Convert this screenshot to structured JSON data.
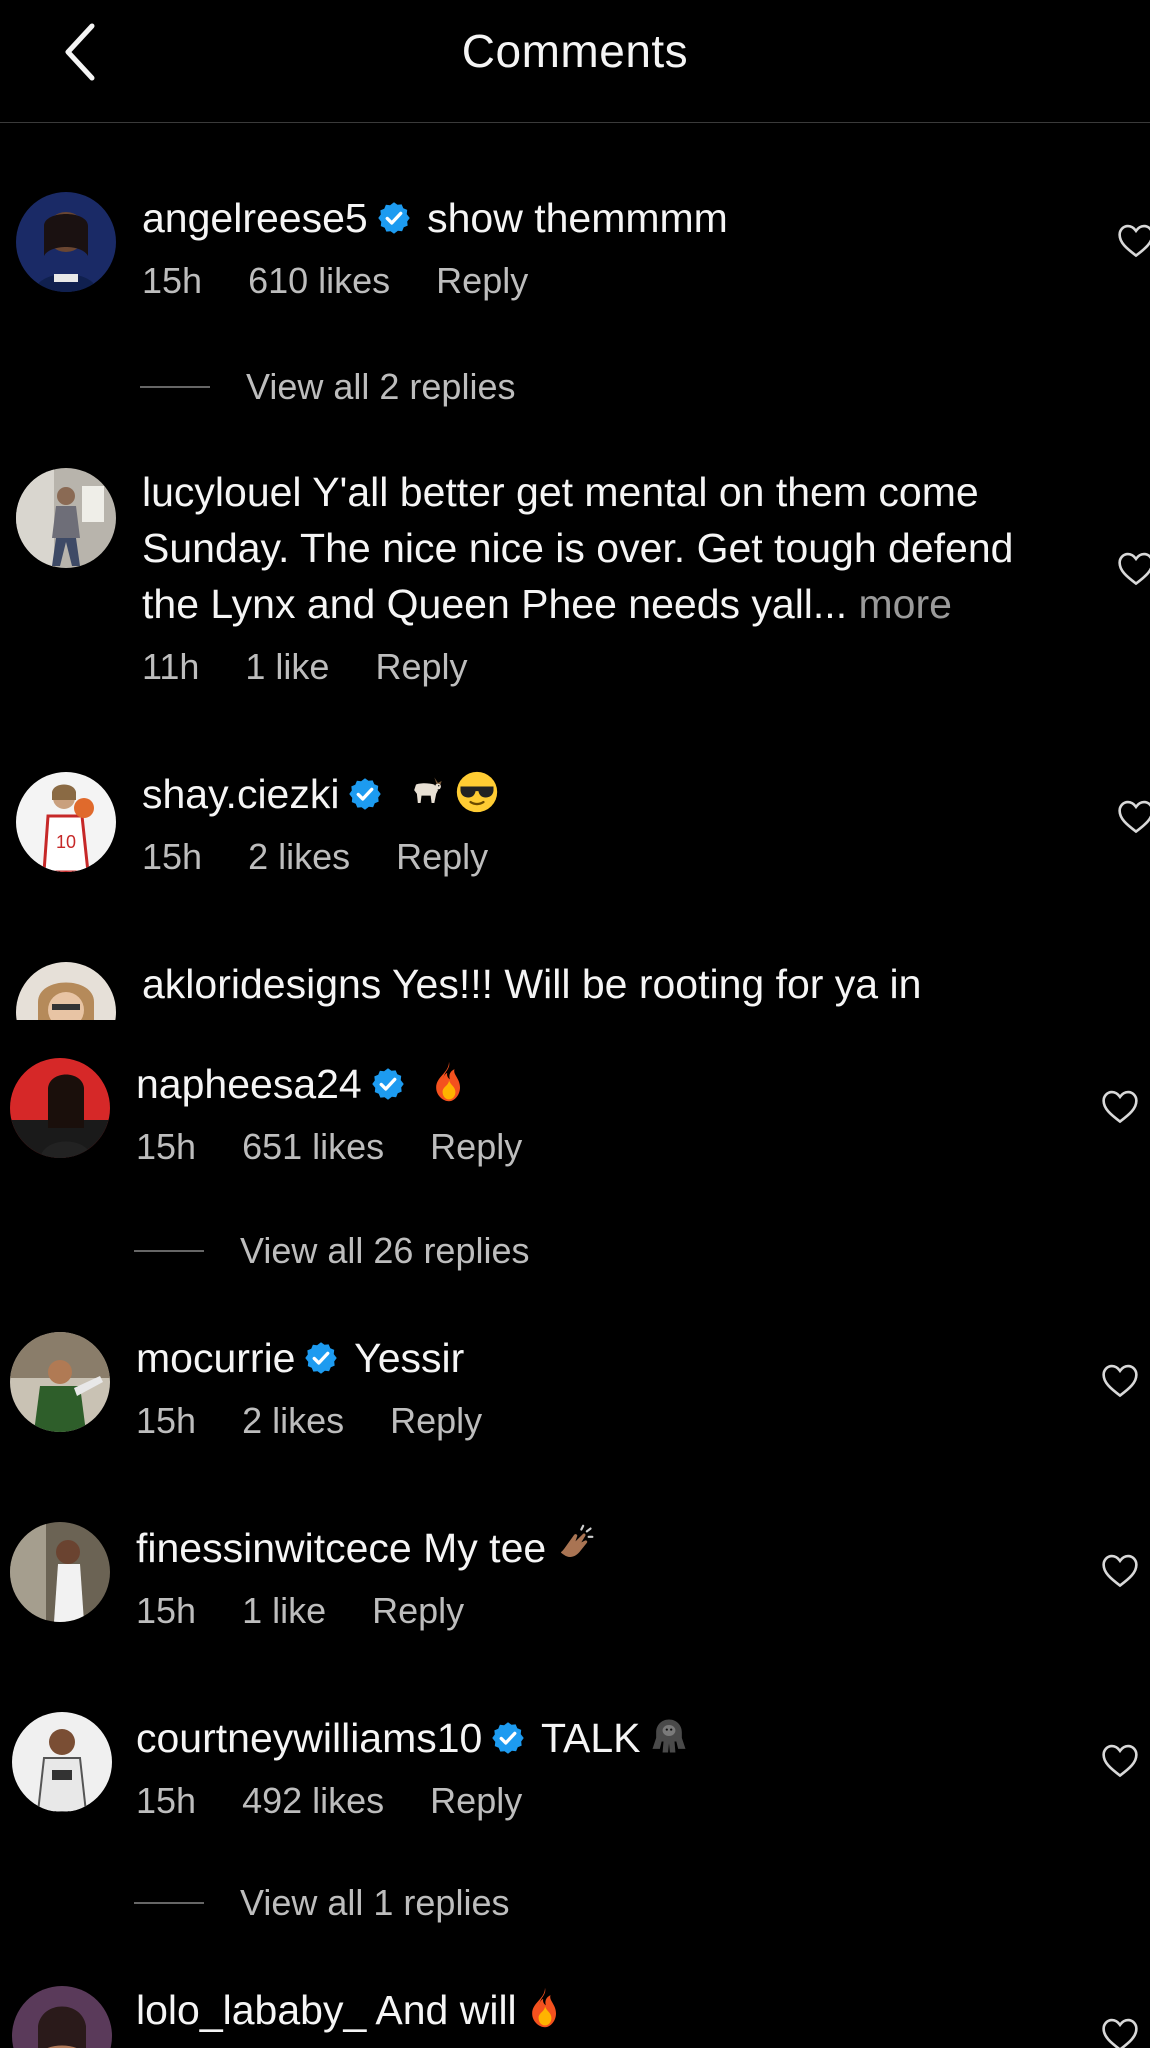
{
  "header": {
    "title": "Comments",
    "back_icon": "chevron-left-icon"
  },
  "colors": {
    "background": "#000000",
    "text": "#f5f5f5",
    "meta_text": "#bdbdbd",
    "verified_badge": "#1d9bf0"
  },
  "comments": [
    {
      "username": "angelreese5",
      "verified": true,
      "text": "show themmmm",
      "time": "15h",
      "likes": "610 likes",
      "reply": "Reply",
      "view_replies": "View all 2 replies"
    },
    {
      "username": "lucylouel",
      "verified": false,
      "text": "Y'all better get mental on them come Sunday. The nice nice is over. Get tough defend the Lynx and Queen Phee needs yall...",
      "more": "more",
      "time": "11h",
      "likes": "1 like",
      "reply": "Reply"
    },
    {
      "username": "shay.ciezki",
      "verified": true,
      "text": "",
      "emojis": [
        "goat-emoji",
        "sunglasses-emoji"
      ],
      "time": "15h",
      "likes": "2 likes",
      "reply": "Reply"
    },
    {
      "username": "akloridesigns",
      "verified": false,
      "text": "Yes!!! Will be rooting for ya in"
    },
    {
      "username": "napheesa24",
      "verified": true,
      "text": "",
      "emojis": [
        "fire-emoji"
      ],
      "time": "15h",
      "likes": "651 likes",
      "reply": "Reply",
      "view_replies": "View all 26 replies"
    },
    {
      "username": "mocurrie",
      "verified": true,
      "text": "Yessir",
      "time": "15h",
      "likes": "2 likes",
      "reply": "Reply"
    },
    {
      "username": "finessinwitcece",
      "verified": false,
      "text": "My tee",
      "emojis": [
        "clapping-hands-emoji"
      ],
      "time": "15h",
      "likes": "1 like",
      "reply": "Reply"
    },
    {
      "username": "courtneywilliams10",
      "verified": true,
      "text": "TALK",
      "emojis": [
        "gorilla-emoji"
      ],
      "time": "15h",
      "likes": "492 likes",
      "reply": "Reply",
      "view_replies": "View all 1 replies"
    },
    {
      "username": "lolo_lababy_",
      "verified": false,
      "text": "And will",
      "emojis": [
        "fire-emoji"
      ]
    }
  ]
}
